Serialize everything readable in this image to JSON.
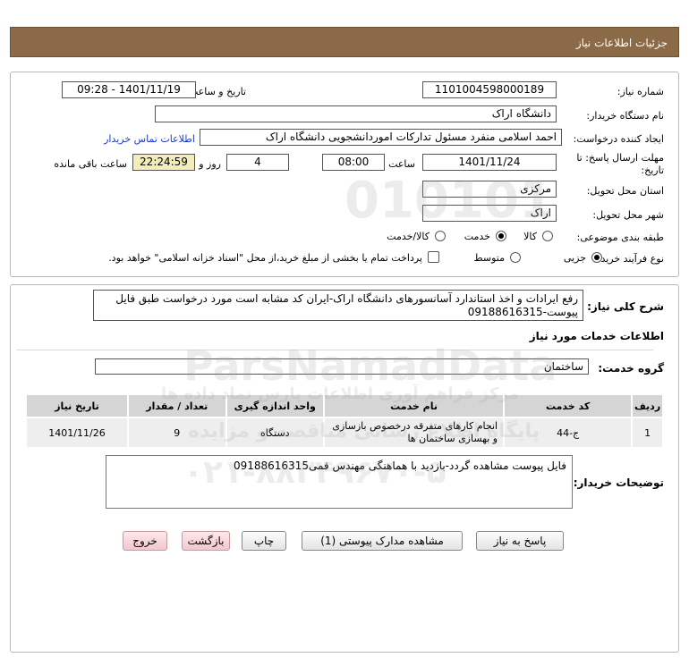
{
  "header": {
    "title": "جزئیات اطلاعات نیاز"
  },
  "form": {
    "need_number_label": "شماره نیاز:",
    "need_number": "1101004598000189",
    "announce_label": "تاریخ و ساعت اعلان عمومی:",
    "announce_value": "1401/11/19 - 09:28",
    "buyer_org_label": "نام دستگاه خریدار:",
    "buyer_org": "دانشگاه اراک",
    "requester_label": "ایجاد کننده درخواست:",
    "requester": "احمد  اسلامی منفرد مسئول تدارکات اموردانشجویی دانشگاه اراک",
    "contact_link": "اطلاعات تماس خریدار",
    "deadline_label": "مهلت ارسال پاسخ: تا تاریخ:",
    "deadline_date": "1401/11/24",
    "time_label": "ساعت",
    "deadline_time": "08:00",
    "days_value": "4",
    "days_label": "روز و",
    "remaining_time": "22:24:59",
    "remaining_label": "ساعت باقی مانده",
    "province_label": "استان محل تحویل:",
    "province": "مرکزی",
    "city_label": "شهر محل تحویل:",
    "city": "اراک",
    "category_label": "طبقه بندی موضوعی:",
    "category_options": [
      "کالا",
      "خدمت",
      "کالا/خدمت"
    ],
    "category_selected": "خدمت",
    "process_label": "نوع فرآیند خرید :",
    "process_options": [
      "جزیی",
      "متوسط"
    ],
    "process_selected": "جزیی",
    "payment_note": "پرداخت تمام یا بخشی از مبلغ خرید،از محل \"اسناد خزانه اسلامی\" خواهد بود."
  },
  "summary": {
    "label": "شرح کلی نیاز:",
    "text": "رفع ایرادات و اخذ استاندارد آسانسورهای دانشگاه اراک-ایران کد مشابه است مورد درخواست طبق فایل پیوست-09188616315"
  },
  "services": {
    "section_title": "اطلاعات خدمات مورد نیاز",
    "group_label": "گروه خدمت:",
    "group_value": "ساختمان",
    "columns": [
      "ردیف",
      "کد خدمت",
      "نام خدمت",
      "واحد اندازه گیری",
      "تعداد / مقدار",
      "تاریخ نیاز"
    ],
    "rows": [
      {
        "row": "1",
        "code": "ج-44",
        "name": "انجام کارهای متفرقه درخصوص بازسازی و بهسازی ساختمان ها",
        "unit": "دستگاه",
        "qty": "9",
        "date": "1401/11/26"
      }
    ]
  },
  "buyer_notes": {
    "label": "توضیحات خریدار:",
    "text": "فایل پیوست مشاهده گردد-بازدید با هماهنگی مهندس قمی09188616315"
  },
  "buttons": {
    "reply": "پاسخ به نیاز",
    "attachments": "مشاهده مدارک پیوستی (1)",
    "print": "چاپ",
    "back": "بازگشت",
    "exit": "خروج"
  },
  "watermark": {
    "digits": "010101",
    "brand": "ParsNamadData",
    "line1": "مرکز فراهم آوری اطلاعات پارس نماد داده ها",
    "line2": "پایگاه اطلاع رسانی مناقصه و مزایده",
    "phone": "۰۲۱-۸۸۳۴۹۶۷۰-۵"
  },
  "colors": {
    "title_bar": "#8b6a48",
    "remaining_bg": "#f3eeb9",
    "link": "#1a3cc8"
  }
}
